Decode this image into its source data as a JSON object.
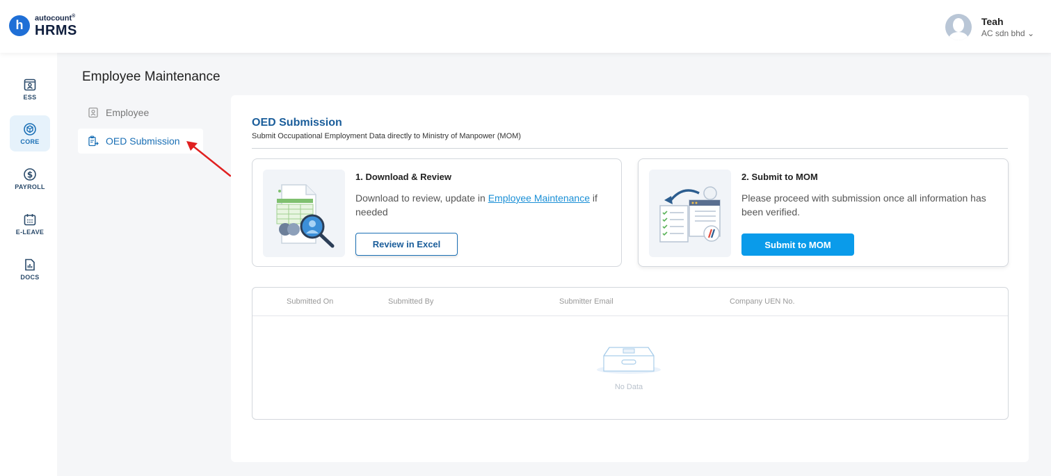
{
  "header": {
    "logo_badge": "h",
    "logo_top": "autocount",
    "logo_top_mark": "®",
    "logo_main": "HRMS",
    "user_name": "Teah",
    "company": "AC sdn bhd",
    "company_chevron": "⌄"
  },
  "sidenav": {
    "items": [
      {
        "label": "ESS",
        "icon": "ess-icon"
      },
      {
        "label": "CORE",
        "icon": "core-cube-icon",
        "active": true
      },
      {
        "label": "PAYROLL",
        "icon": "dollar-circle-icon"
      },
      {
        "label": "E-LEAVE",
        "icon": "calendar-icon"
      },
      {
        "label": "DOCS",
        "icon": "document-chart-icon"
      }
    ]
  },
  "page": {
    "title": "Employee Maintenance"
  },
  "submenu": {
    "items": [
      {
        "label": "Employee",
        "icon": "employee-card-icon",
        "selected": false
      },
      {
        "label": "OED Submission",
        "icon": "submission-icon",
        "selected": true
      }
    ]
  },
  "section": {
    "title": "OED Submission",
    "subtitle": "Submit Occupational Employment Data directly to Ministry of Manpower (MOM)"
  },
  "card_download": {
    "title": "1. Download & Review",
    "desc_prefix": "Download to review, update in ",
    "desc_link": "Employee Maintenance",
    "desc_suffix": " if needed",
    "button": "Review in Excel"
  },
  "card_submit": {
    "title": "2. Submit to MOM",
    "desc": "Please proceed with submission once all information has been verified.",
    "button": "Submit to MOM"
  },
  "table": {
    "columns": [
      "Submitted On",
      "Submitted By",
      "Submitter Email",
      "Company UEN No."
    ],
    "empty_text": "No Data"
  },
  "colors": {
    "accent": "#1a6fb5",
    "primary_button": "#0a9bea",
    "annotation_arrow": "#e02020"
  }
}
